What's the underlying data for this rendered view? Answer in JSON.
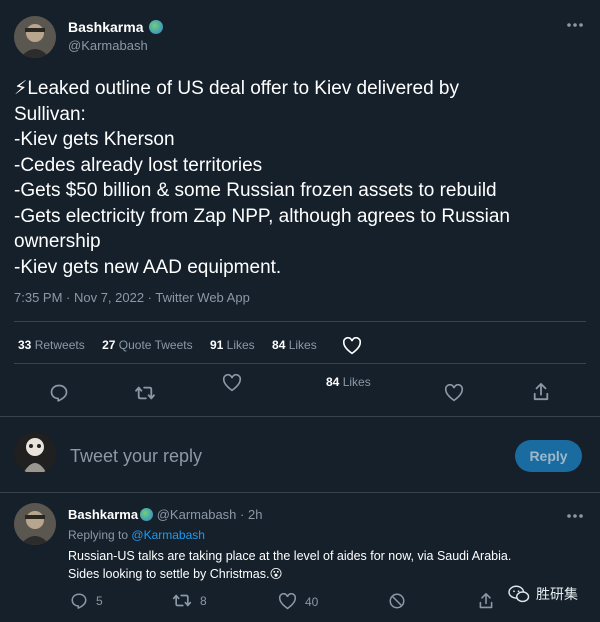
{
  "main_tweet": {
    "display_name": "Bashkarma",
    "handle": "@Karmabash",
    "body_lines": [
      "⚡Leaked outline of US deal offer to Kiev delivered by",
      "Sullivan:",
      "-Kiev gets Kherson",
      "-Cedes already lost territories",
      "-Gets $50 billion & some Russian frozen assets to rebuild",
      "-Gets electricity from Zap NPP, although agrees to Russian",
      "ownership",
      "-Kiev gets new AAD equipment."
    ],
    "meta": "7:35 PM · Nov 7, 2022 · Twitter Web App",
    "stats": {
      "retweets_count": "33",
      "retweets_label": "Retweets",
      "quotes_count": "27",
      "quotes_label": "Quote Tweets",
      "likes_count": "91",
      "likes_label": "Likes",
      "likes2_count": "84",
      "likes2_label": "Likes"
    },
    "floating_likes_count": "84",
    "floating_likes_label": "Likes"
  },
  "reply_box": {
    "placeholder": "Tweet your reply",
    "button_label": "Reply"
  },
  "reply_tweet": {
    "display_name": "Bashkarma",
    "handle": "@Karmabash",
    "time": "· 2h",
    "replying_prefix": "Replying to",
    "replying_to": "@Karmabash",
    "body_lines": [
      "Russian-US talks are taking place at the level of aides for now, via Saudi Arabia.",
      "Sides looking to settle by Christmas.😮"
    ],
    "reply_count": "5",
    "retweet_count": "8",
    "like_count": "40"
  },
  "watermark": {
    "text": "胜研集"
  },
  "colors": {
    "background": "#15202b",
    "accent": "#1d9bf0",
    "muted": "#8b98a5",
    "divider": "#38444d"
  }
}
